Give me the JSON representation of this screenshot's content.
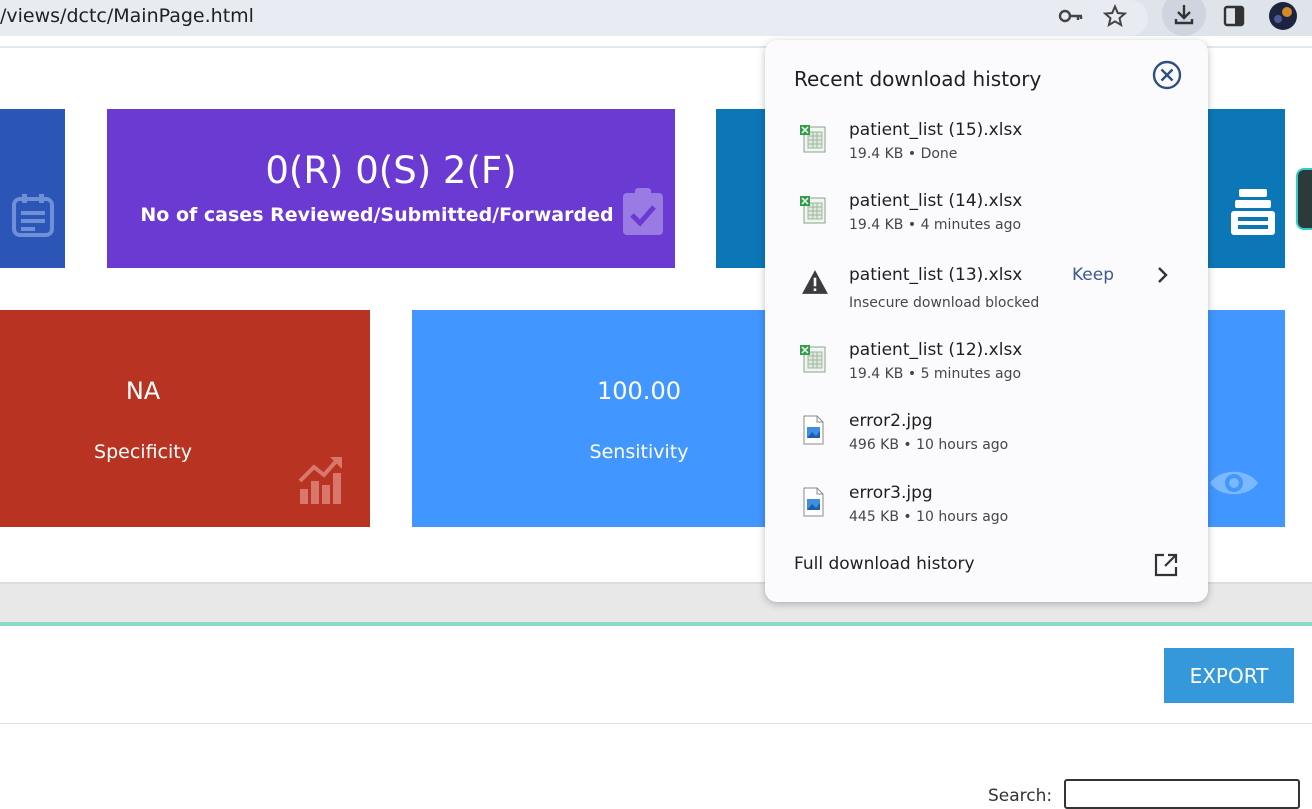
{
  "browser": {
    "url": "/views/dctc/MainPage.html",
    "icons": [
      "key-icon",
      "star-icon",
      "download-icon",
      "side-panel-icon",
      "profile-avatar"
    ]
  },
  "dashboard": {
    "cards_top": [
      {
        "value": "0(R) 0(S) 2(F)",
        "label": "No of cases Reviewed/Submitted/Forwarded",
        "color": "#6a3ad3",
        "icon": "clipboard-check-icon"
      }
    ],
    "cards_bottom": [
      {
        "value": "NA",
        "label": "Specificity",
        "color": "#b93323",
        "icon": "chart-up-icon"
      },
      {
        "value": "100.00",
        "label": "Sensitivity",
        "color": "#4197ff",
        "icon": ""
      }
    ],
    "side_card_colors": {
      "left_blue": "#2b56b8",
      "right_teal": "#0b77b7",
      "right_light": "#4197ff"
    },
    "export_label": "EXPORT",
    "search_label": "Search:"
  },
  "downloads": {
    "title": "Recent download history",
    "items": [
      {
        "name": "patient_list (15).xlsx",
        "meta": "19.4 KB • Done",
        "icon": "excel-file-icon"
      },
      {
        "name": "patient_list (14).xlsx",
        "meta": "19.4 KB • 4 minutes ago",
        "icon": "excel-file-icon"
      },
      {
        "name": "patient_list (13).xlsx",
        "meta": "Insecure download blocked",
        "icon": "warning-icon",
        "action": "Keep"
      },
      {
        "name": "patient_list (12).xlsx",
        "meta": "19.4 KB • 5 minutes ago",
        "icon": "excel-file-icon"
      },
      {
        "name": "error2.jpg",
        "meta": "496 KB • 10 hours ago",
        "icon": "image-file-icon"
      },
      {
        "name": "error3.jpg",
        "meta": "445 KB • 10 hours ago",
        "icon": "image-file-icon"
      }
    ],
    "full_history_label": "Full download history"
  }
}
